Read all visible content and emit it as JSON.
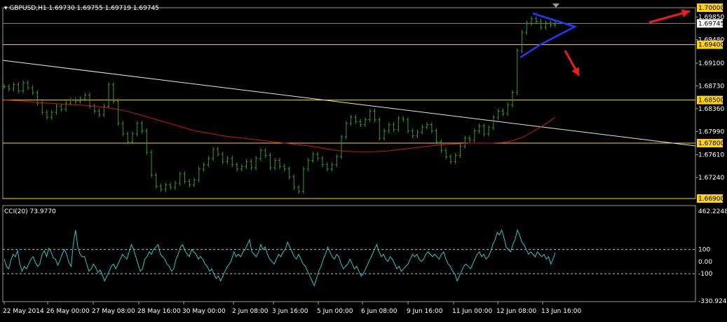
{
  "header": {
    "menu_glyph": "▾",
    "symbol": "GBPUSD,H1",
    "ohlc": "1.69730 1.69755 1.69719 1.69745"
  },
  "indicator": {
    "label": "CCI(20) 73.9770"
  },
  "colors": {
    "background": "#000000",
    "price": "#3b9a2a",
    "ma": "#d0141d",
    "trendline": "#e5e5e5",
    "level": "#ffd21a",
    "triangle": "#1f3cf5",
    "arrow": "#e81e1e",
    "cci": "#36c3c3",
    "bidline": "#8a8a8a"
  },
  "chart_data": [
    {
      "type": "line",
      "description_series": "hourly price bars",
      "ylim": [
        1.669,
        1.7
      ],
      "x": [
        "22 May 2014",
        "26 May 00:00",
        "27 May 08:00",
        "28 May 16:00",
        "30 May 00:00",
        "2 Jun 08:00",
        "3 Jun 16:00",
        "5 Jun 00:00",
        "6 Jun 08:00",
        "9 Jun 16:00",
        "11 Jun 00:00",
        "12 Jun 08:00",
        "13 Jun 16:00"
      ],
      "y_ticks": [
        "1.70000",
        "1.69850",
        "1.69745",
        "1.69480",
        "1.69400",
        "1.69100",
        "1.68730",
        "1.68500",
        "1.68360",
        "1.67990",
        "1.67800",
        "1.67610",
        "1.67240",
        "1.66900"
      ],
      "highlighted_ticks": [
        "1.70000",
        "1.69400",
        "1.68500",
        "1.67800",
        "1.66900"
      ],
      "current_price_tick": "1.69745",
      "horizontal_levels": [
        1.694,
        1.685,
        1.678,
        1.669
      ],
      "series": [
        {
          "values": [
            1.6872,
            1.6868,
            1.6875,
            1.6865,
            1.6878,
            1.687,
            1.6862,
            1.6845,
            1.683,
            1.6822,
            1.683,
            1.684,
            1.6835,
            1.6845,
            1.685,
            1.6848,
            1.6852,
            1.6858,
            1.684,
            1.6832,
            1.6826,
            1.684,
            1.6875,
            1.6848,
            1.6812,
            1.6795,
            1.6782,
            1.6795,
            1.6812,
            1.68,
            1.6765,
            1.6728,
            1.671,
            1.6705,
            1.6712,
            1.6708,
            1.6715,
            1.673,
            1.6718,
            1.6712,
            1.672,
            1.6738,
            1.6745,
            1.6755,
            1.677,
            1.6762,
            1.675,
            1.6755,
            1.6745,
            1.6738,
            1.6742,
            1.675,
            1.674,
            1.6755,
            1.6768,
            1.676,
            1.674,
            1.6752,
            1.6742,
            1.6738,
            1.6725,
            1.6708,
            1.6702,
            1.6738,
            1.6752,
            1.6762,
            1.6755,
            1.6745,
            1.6738,
            1.6745,
            1.6758,
            1.679,
            1.6812,
            1.6822,
            1.6815,
            1.681,
            1.6818,
            1.6832,
            1.6818,
            1.6788,
            1.68,
            1.681,
            1.6802,
            1.682,
            1.6818,
            1.68,
            1.6792,
            1.6798,
            1.6806,
            1.681,
            1.68,
            1.6782,
            1.6768,
            1.6758,
            1.675,
            1.676,
            1.6775,
            1.6788,
            1.6785,
            1.68,
            1.6808,
            1.6795,
            1.6805,
            1.6822,
            1.6832,
            1.6828,
            1.6842,
            1.6862,
            1.693,
            1.696,
            1.6975,
            1.6982,
            1.6978,
            1.6968,
            1.6975,
            1.6972,
            1.6975
          ]
        },
        {
          "name": "",
          "values": [
            1.685,
            1.6849,
            1.6848,
            1.6846,
            1.6845,
            1.6844,
            1.6843,
            1.6842,
            1.6841,
            1.6839,
            1.6837,
            1.6834,
            1.683,
            1.6825,
            1.682,
            1.6815,
            1.681,
            1.6805,
            1.68,
            1.6797,
            1.6794,
            1.6791,
            1.6789,
            1.6787,
            1.6785,
            1.6783,
            1.6781,
            1.6779,
            1.6777,
            1.6775,
            1.6772,
            1.6769,
            1.6767,
            1.6766,
            1.6766,
            1.6766,
            1.6767,
            1.6769,
            1.6771,
            1.6773,
            1.6775,
            1.6777,
            1.6778,
            1.6779,
            1.678,
            1.678,
            1.678,
            1.6781,
            1.6784,
            1.679,
            1.68,
            1.681,
            1.6822
          ]
        }
      ]
    },
    {
      "type": "line",
      "title": "CCI(20) 73.9770",
      "ylim": [
        -330.924,
        462.2248
      ],
      "y_ticks": [
        "462.2248",
        "100",
        "0.00",
        "-100",
        "-330.924"
      ],
      "levels": [
        100,
        -100
      ],
      "series": [
        {
          "values": [
            20,
            -40,
            -60,
            10,
            60,
            40,
            90,
            -20,
            -80,
            -40,
            -60,
            -20,
            20,
            40,
            -10,
            -40,
            -20,
            60,
            90,
            40,
            110,
            80,
            30,
            20,
            -30,
            10,
            60,
            100,
            60,
            -10,
            -40,
            150,
            260,
            120,
            60,
            40,
            40,
            -20,
            -80,
            -60,
            -20,
            -50,
            -90,
            -70,
            -110,
            -160,
            -120,
            -80,
            -40,
            -20,
            -60,
            -20,
            20,
            60,
            40,
            20,
            80,
            140,
            100,
            40,
            -20,
            -80,
            -60,
            20,
            40,
            80,
            60,
            100,
            120,
            140,
            60,
            40,
            20,
            -20,
            -40,
            -80,
            -60,
            20,
            60,
            120,
            140,
            90,
            60,
            40,
            100,
            80,
            60,
            20,
            40,
            20,
            -20,
            -40,
            -80,
            -60,
            -100,
            -140,
            -120,
            -160,
            -120,
            -80,
            -40,
            -20,
            20,
            80,
            40,
            60,
            40,
            80,
            100,
            140,
            180,
            80,
            60,
            40,
            80,
            140,
            100,
            120,
            60,
            20,
            0,
            -20,
            20,
            60,
            40,
            80,
            100,
            160,
            120,
            80,
            40,
            20,
            60,
            20,
            -20,
            -40,
            -80,
            -120,
            -160,
            -200,
            -140,
            -80,
            -40,
            20,
            60,
            120,
            80,
            40,
            20,
            60,
            40,
            -20,
            -60,
            -40,
            -20,
            20,
            -20,
            -60,
            -40,
            -80,
            -120,
            -100,
            -60,
            -20,
            20,
            60,
            100,
            140,
            80,
            40,
            60,
            20,
            0,
            40,
            20,
            -20,
            -60,
            -40,
            -80,
            -60,
            -40,
            -20,
            20,
            60,
            40,
            60,
            20,
            0,
            20,
            60,
            80,
            60,
            40,
            60,
            40,
            20,
            60,
            80,
            20,
            -20,
            -40,
            -80,
            -100,
            -160,
            -120,
            -80,
            -40,
            -20,
            -40,
            -60,
            -20,
            20,
            60,
            80,
            40,
            60,
            20,
            40,
            80,
            140,
            180,
            240,
            220,
            260,
            200,
            120,
            100,
            80,
            140,
            180,
            260,
            220,
            160,
            140,
            100,
            60,
            80,
            60,
            40,
            80,
            60,
            40,
            60,
            20,
            40,
            -20,
            20,
            74
          ]
        }
      ]
    }
  ],
  "annotations": {
    "triangle": "blue symmetrical triangle at top",
    "arrows": [
      "up",
      "down"
    ]
  }
}
